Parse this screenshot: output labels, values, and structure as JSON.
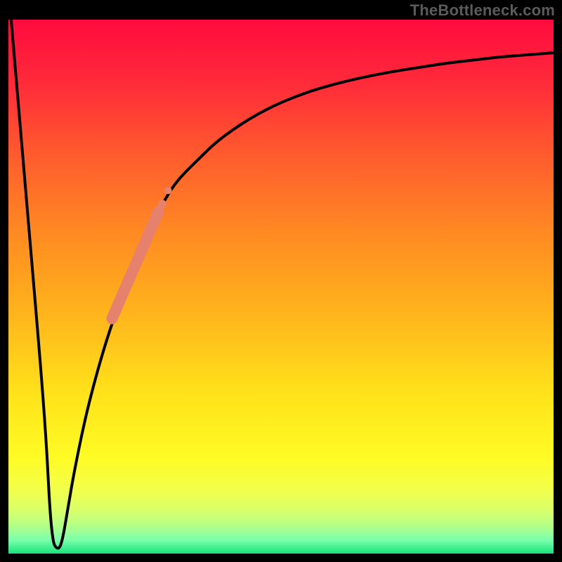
{
  "attribution": "TheBottleneck.com",
  "chart_data": {
    "type": "line",
    "title": "",
    "xlabel": "",
    "ylabel": "",
    "xlim": [
      0,
      100
    ],
    "ylim": [
      0,
      100
    ],
    "grid": false,
    "legend": false,
    "gradient_stops": [
      {
        "offset": 0.0,
        "color": "#ff0b3e"
      },
      {
        "offset": 0.12,
        "color": "#ff2b3a"
      },
      {
        "offset": 0.25,
        "color": "#ff5a2e"
      },
      {
        "offset": 0.4,
        "color": "#ff8a22"
      },
      {
        "offset": 0.55,
        "color": "#ffb41c"
      },
      {
        "offset": 0.7,
        "color": "#ffe21a"
      },
      {
        "offset": 0.82,
        "color": "#fffb25"
      },
      {
        "offset": 0.88,
        "color": "#f2ff4a"
      },
      {
        "offset": 0.92,
        "color": "#d8ff6a"
      },
      {
        "offset": 0.95,
        "color": "#b0ff8a"
      },
      {
        "offset": 0.975,
        "color": "#7affac"
      },
      {
        "offset": 1.0,
        "color": "#18e37a"
      }
    ],
    "series": [
      {
        "name": "bottleneck-curve",
        "color": "#000000",
        "x": [
          0.5,
          2,
          4,
          6,
          7,
          7.6,
          8.2,
          8.8,
          9.4,
          10,
          11,
          12,
          14,
          16,
          18,
          20,
          22,
          24,
          26,
          28,
          30,
          32,
          35,
          38,
          42,
          46,
          50,
          55,
          60,
          65,
          70,
          75,
          80,
          85,
          90,
          95,
          100
        ],
        "y": [
          100,
          82,
          58,
          34,
          20,
          8,
          2,
          1,
          1,
          3,
          9,
          15,
          25,
          33,
          40,
          46,
          52,
          57,
          61.5,
          65,
          68.5,
          71,
          74,
          77,
          80,
          82.5,
          84.5,
          86.5,
          88,
          89.2,
          90.2,
          91,
          91.8,
          92.4,
          93,
          93.4,
          93.8
        ]
      }
    ],
    "highlight_segment": {
      "name": "curve-highlight",
      "color": "#e5816d",
      "x_range": [
        19,
        27.5
      ],
      "points": [
        {
          "x": 19,
          "y": 44
        },
        {
          "x": 27.5,
          "y": 64
        }
      ],
      "dots": [
        {
          "x": 27.2,
          "y": 63.2
        },
        {
          "x": 28.2,
          "y": 65.5
        },
        {
          "x": 29.3,
          "y": 68.0
        }
      ]
    }
  }
}
